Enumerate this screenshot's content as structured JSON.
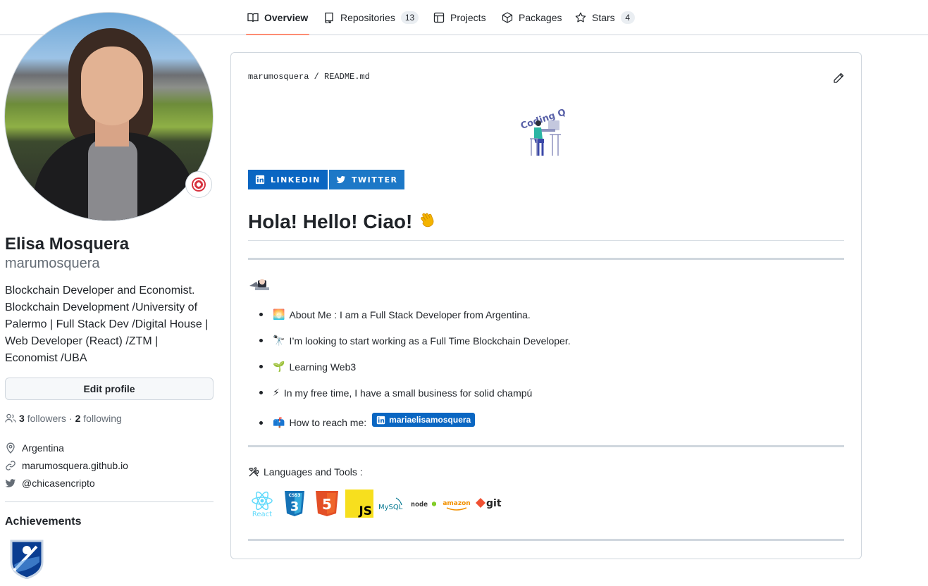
{
  "nav": {
    "tabs": [
      {
        "label": "Overview",
        "icon": "book-icon"
      },
      {
        "label": "Repositories",
        "count": "13",
        "icon": "repo-icon"
      },
      {
        "label": "Projects",
        "icon": "table-icon"
      },
      {
        "label": "Packages",
        "icon": "package-icon"
      },
      {
        "label": "Stars",
        "count": "4",
        "icon": "star-icon"
      }
    ]
  },
  "profile": {
    "fullname": "Elisa Mosquera",
    "login": "marumosquera",
    "bio": "Blockchain Developer and Economist. Blockchain Development /University of Palermo | Full Stack Dev /Digital House | Web Developer (React) /ZTM | Economist /UBA",
    "edit_label": "Edit profile",
    "followers_count": "3",
    "followers_label": "followers",
    "following_count": "2",
    "following_label": "following",
    "location": "Argentina",
    "website": "marumosquera.github.io",
    "twitter": "@chicasencripto",
    "achievements_title": "Achievements"
  },
  "readme": {
    "owner": "marumosquera",
    "separator": "/",
    "file": "README.md",
    "logo_text": "Coding Q",
    "linkedin_label": "LINKEDIN",
    "twitter_label": "TWITTER",
    "heading": "Hola! Hello! Ciao!",
    "bullets": [
      {
        "emoji": "🌅",
        "text": "About Me : I am a Full Stack Developer from Argentina."
      },
      {
        "emoji": "🔭",
        "text": "I’m looking to start working as a Full Time Blockchain Developer."
      },
      {
        "emoji": "🌱",
        "text": "Learning Web3"
      },
      {
        "emoji": "⚡",
        "text": "In my free time, I have a small business for solid champú"
      },
      {
        "emoji": "📫",
        "text": "How to reach me:",
        "badge": "mariaelisamosquera"
      }
    ],
    "languages_title": "Languages and Tools :",
    "tools": [
      "React",
      "CSS3",
      "HTML5",
      "JS",
      "MySQL",
      "node",
      "amazon",
      "git"
    ]
  },
  "colors": {
    "accent_tab": "#fd8c73",
    "linkedin": "#0a66c2",
    "twitter_button": "#1d78c7"
  }
}
